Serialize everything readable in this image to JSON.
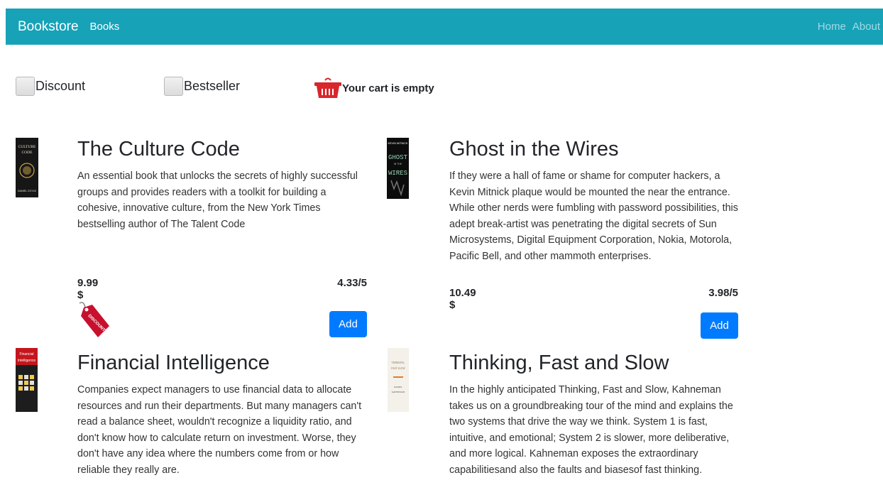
{
  "navbar": {
    "brand": "Bookstore",
    "books_link": "Books",
    "home_link": "Home",
    "about_link": "About"
  },
  "filters": {
    "discount_label": "Discount",
    "bestseller_label": "Bestseller",
    "cart_label": "Your cart is empty"
  },
  "books": [
    {
      "title": "The Culture Code",
      "description": "An essential book that unlocks the secrets of highly successful groups and provides readers with a toolkit for building a cohesive, innovative culture, from the New York Times bestselling author of The Talent Code",
      "price": "9.99 $",
      "rating": "4.33/5",
      "add_label": "Add",
      "discount": true,
      "cover_title": "THE CULTURE CODE",
      "cover_author": "DANIEL COYLE"
    },
    {
      "title": "Ghost in the Wires",
      "description": "If they were a hall of fame or shame for computer hackers, a Kevin Mitnick plaque would be mounted the near the entrance. While other nerds were fumbling with password possibilities, this adept break-artist was penetrating the digital secrets of Sun Microsystems, Digital Equipment Corporation, Nokia, Motorola, Pacific Bell, and other mammoth enterprises.",
      "price": "10.49 $",
      "rating": "3.98/5",
      "add_label": "Add",
      "cover_author": "KEVIN MITNICK",
      "cover_title": "GHOST WIRES"
    },
    {
      "title": "Financial Intelligence",
      "description": "Companies expect managers to use financial data to allocate resources and run their departments. But many managers can't read a balance sheet, wouldn't recognize a liquidity ratio, and don't know how to calculate return on investment. Worse, they don't have any idea where the numbers come from or how reliable they really are.",
      "cover_title": "Financial Intelligence"
    },
    {
      "title": "Thinking, Fast and Slow",
      "description": "In the highly anticipated Thinking, Fast and Slow, Kahneman takes us on a groundbreaking tour of the mind and explains the two systems that drive the way we think. System 1 is fast, intuitive, and emotional; System 2 is slower, more deliberative, and more logical. Kahneman exposes the extraordinary capabilitiesand also the faults and biasesof fast thinking.",
      "cover_title": "THINKING, FAST SLOW",
      "cover_author": "DANIEL KAHNEMAN"
    }
  ],
  "icons": {
    "cart": "basket-icon",
    "discount": "discount-tag-icon"
  },
  "colors": {
    "navbar": "#17a2b8",
    "button": "#007bff",
    "basket": "#d9262b",
    "discount_tag": "#c8102e"
  }
}
